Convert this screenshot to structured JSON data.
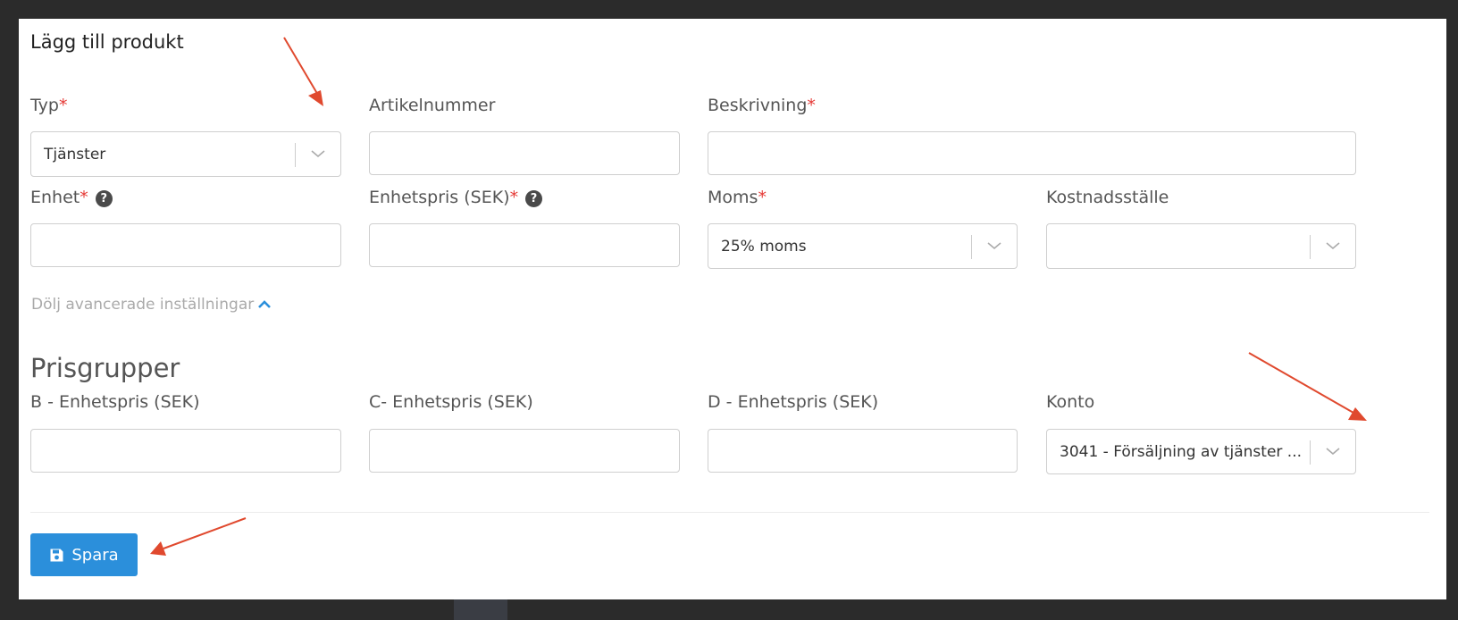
{
  "modal": {
    "title": "Lägg till produkt"
  },
  "fields": {
    "typ": {
      "label": "Typ",
      "required_mark": "*",
      "value": "Tjänster"
    },
    "artikelnummer": {
      "label": "Artikelnummer",
      "value": ""
    },
    "beskrivning": {
      "label": "Beskrivning",
      "required_mark": "*",
      "value": ""
    },
    "enhet": {
      "label": "Enhet",
      "required_mark": "*",
      "help": "?",
      "value": ""
    },
    "enhetspris": {
      "label": "Enhetspris (SEK)",
      "required_mark": "*",
      "help": "?",
      "value": ""
    },
    "moms": {
      "label": "Moms",
      "required_mark": "*",
      "value": "25% moms"
    },
    "kostnadsstalle": {
      "label": "Kostnadsställe",
      "value": ""
    }
  },
  "advanced": {
    "toggle_label": "Dölj avancerade inställningar"
  },
  "prisgrupper": {
    "title": "Prisgrupper",
    "b": {
      "label": "B - Enhetspris (SEK)",
      "value": ""
    },
    "c": {
      "label": "C- Enhetspris (SEK)",
      "value": ""
    },
    "d": {
      "label": "D - Enhetspris (SEK)",
      "value": ""
    },
    "konto": {
      "label": "Konto",
      "value": "3041 - Försäljning av tjänster ..."
    }
  },
  "actions": {
    "save_label": "Spara"
  },
  "colors": {
    "required": "#e53935",
    "primary": "#2b8fdb",
    "annotation_arrow": "#e0492e"
  },
  "icons": {
    "chevron": "chevron-down-icon",
    "toggle": "chevron-up-icon",
    "save": "floppy-disk-icon",
    "help": "question-circle-icon"
  }
}
